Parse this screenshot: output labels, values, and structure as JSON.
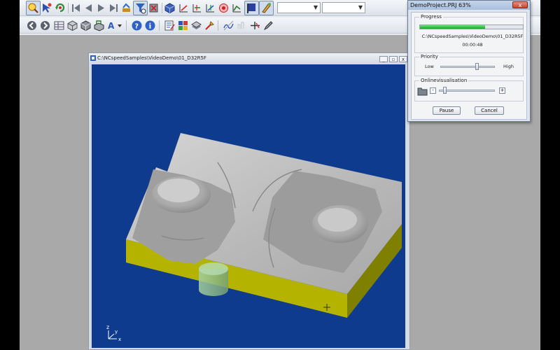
{
  "app": {
    "toolbar_row1": {
      "icons": [
        "zoom-window-icon",
        "select-arrow-icon",
        "rotate-icon",
        "first-frame-icon",
        "previous-frame-icon",
        "play-icon",
        "last-frame-icon",
        "tool-path-icon",
        "simulation-filter-icon",
        "stop-icon",
        "solid-view-icon",
        "axis-x-icon",
        "axis-y-icon",
        "axis-z-icon",
        "target-icon",
        "deviation-icon",
        "flag-icon",
        "brush-icon"
      ],
      "combo1_value": "",
      "combo2_value": ""
    },
    "toolbar_row2": {
      "icons": [
        "back-circle-icon",
        "forward-circle-icon",
        "table-icon",
        "cube-outline-icon",
        "cube-solid-icon",
        "stock-icon",
        "text-style-icon",
        "help-icon",
        "info-icon",
        "list-edit-icon",
        "grid-icon",
        "layer-icon",
        "tool-icon",
        "wave-icon",
        "gauge-icon",
        "split-icon",
        "pen-icon"
      ]
    },
    "document": {
      "title": "C:\\NCspeedSamples\\VideoDemo\\01_D32R5F",
      "controls": {
        "minimize": "_",
        "maximize": "▫",
        "close": "x"
      },
      "axis_labels": {
        "z": "z",
        "y": "y",
        "x": "x"
      },
      "colors": {
        "viewport_bg": "#0f3b8f",
        "stock_top": "#b8b8b8",
        "stock_side": "#b4b400",
        "tool": "#8fbf8f"
      }
    }
  },
  "progress_dialog": {
    "title": "DemoProject.PRJ 63%",
    "close_label": "x",
    "progress": {
      "label": "Progress",
      "value": 0.63,
      "path": "C:\\NCspeedSamples\\VideoDemo\\01_D32R5F",
      "elapsed": "00:00:48"
    },
    "priority": {
      "label": "Priority",
      "low": "Low",
      "high": "High",
      "value": 0.68
    },
    "visualisation": {
      "label": "Onlinevisualisation",
      "minus": "-",
      "plus": "+",
      "value": 0.08
    },
    "buttons": {
      "pause": "Pause",
      "cancel": "Cancel"
    }
  }
}
